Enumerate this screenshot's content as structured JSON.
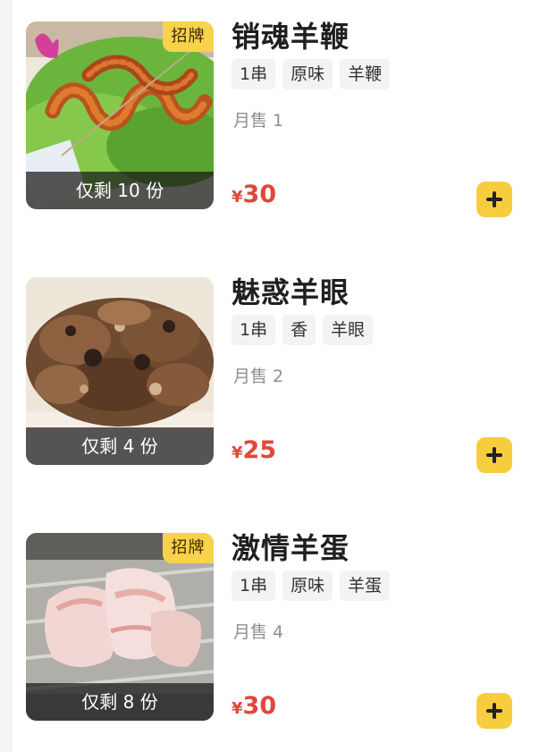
{
  "items": [
    {
      "name": "销魂羊鞭",
      "badge": "招牌",
      "stock": "仅剩 10 份",
      "tags": [
        "1串",
        "原味",
        "羊鞭"
      ],
      "sales": "月售 1",
      "currency": "¥",
      "price": "30",
      "image_icon": "grilled-skewer-image"
    },
    {
      "name": "魅惑羊眼",
      "badge": "",
      "stock": "仅剩 4 份",
      "tags": [
        "1串",
        "香",
        "羊眼"
      ],
      "sales": "月售 2",
      "currency": "¥",
      "price": "25",
      "image_icon": "grilled-meat-image"
    },
    {
      "name": "激情羊蛋",
      "badge": "招牌",
      "stock": "仅剩 8 份",
      "tags": [
        "1串",
        "原味",
        "羊蛋"
      ],
      "sales": "月售 4",
      "currency": "¥",
      "price": "30",
      "image_icon": "raw-meat-image"
    }
  ],
  "colors": {
    "accent_yellow": "#f6cd3e",
    "price_red": "#e0483a",
    "tag_bg": "#f3f3f3",
    "muted_text": "#8f8f8f"
  },
  "icons": {
    "add_button": "plus-icon"
  }
}
